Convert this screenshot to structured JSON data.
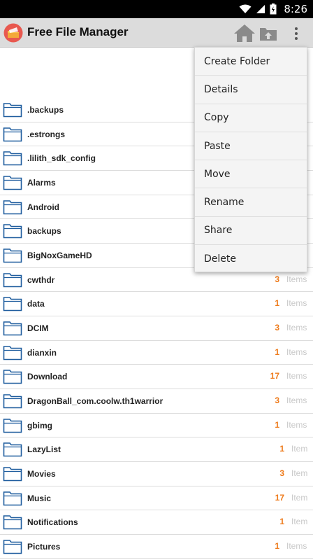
{
  "status_bar": {
    "time": "8:26",
    "icons": [
      "wifi-icon",
      "cell-signal-icon",
      "battery-icon"
    ]
  },
  "app_bar": {
    "title": "Free File Manager",
    "icons": [
      "app-logo-icon",
      "home-icon",
      "folder-up-icon",
      "overflow-menu-icon"
    ]
  },
  "colors": {
    "app_bar": "#dcdcdc",
    "count_accent": "#ee7a1a",
    "folder_blue": "#1f5d9e"
  },
  "files": [
    {
      "name": ".backups",
      "count": "",
      "unit": ""
    },
    {
      "name": ".estrongs",
      "count": "",
      "unit": ""
    },
    {
      "name": ".lilith_sdk_config",
      "count": "",
      "unit": ""
    },
    {
      "name": "Alarms",
      "count": "",
      "unit": ""
    },
    {
      "name": "Android",
      "count": "",
      "unit": ""
    },
    {
      "name": "backups",
      "count": "",
      "unit": ""
    },
    {
      "name": "BigNoxGameHD",
      "count": "",
      "unit": ""
    },
    {
      "name": "cwthdr",
      "count": "3",
      "unit": "Items"
    },
    {
      "name": "data",
      "count": "1",
      "unit": "Items"
    },
    {
      "name": "DCIM",
      "count": "3",
      "unit": "Items"
    },
    {
      "name": "dianxin",
      "count": "1",
      "unit": "Items"
    },
    {
      "name": "Download",
      "count": "17",
      "unit": "Items"
    },
    {
      "name": "DragonBall_com.coolw.th1warrior",
      "count": "3",
      "unit": "Items"
    },
    {
      "name": "gbimg",
      "count": "1",
      "unit": "Items"
    },
    {
      "name": "LazyList",
      "count": "1",
      "unit": "Item"
    },
    {
      "name": "Movies",
      "count": "3",
      "unit": "Item"
    },
    {
      "name": "Music",
      "count": "17",
      "unit": "Item"
    },
    {
      "name": "Notifications",
      "count": "1",
      "unit": "Item"
    },
    {
      "name": "Pictures",
      "count": "1",
      "unit": "Items"
    }
  ],
  "menu": {
    "items": [
      "Create Folder",
      "Details",
      "Copy",
      "Paste",
      "Move",
      "Rename",
      "Share",
      "Delete"
    ]
  }
}
